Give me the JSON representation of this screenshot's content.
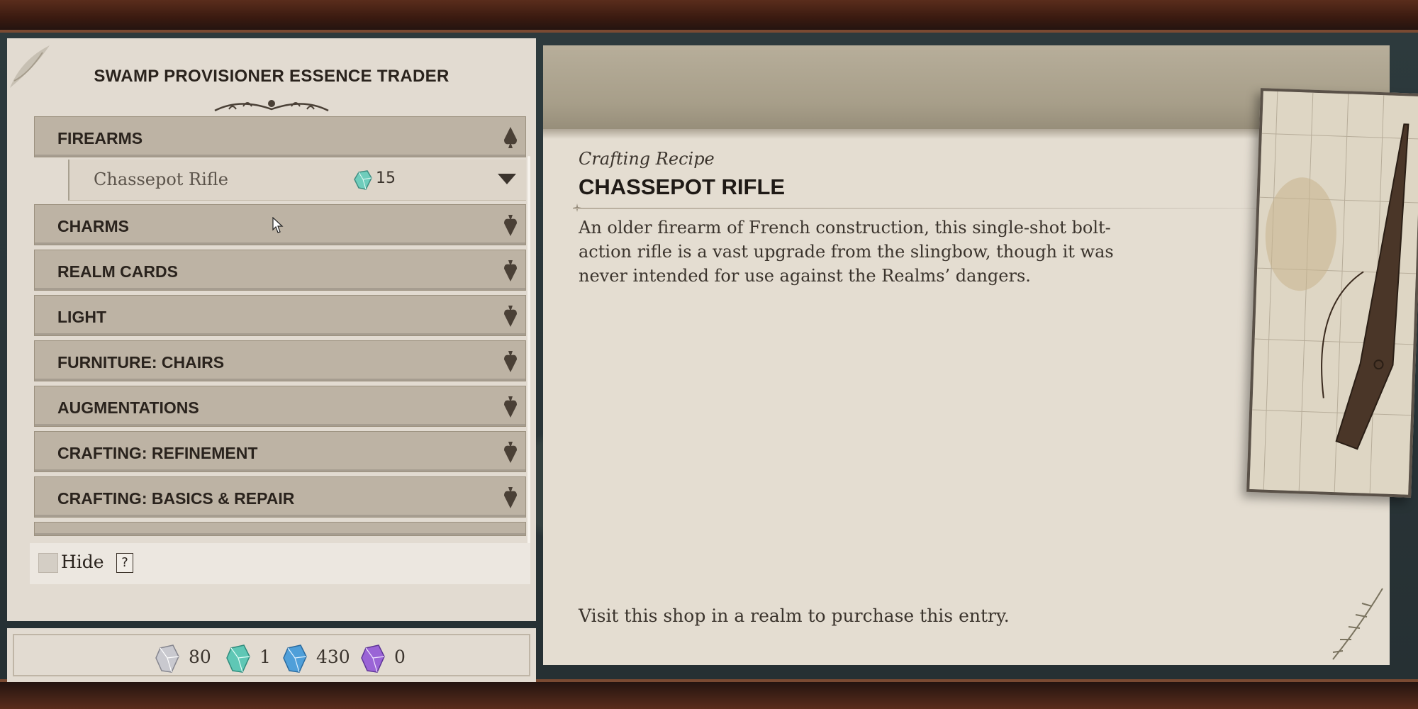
{
  "shop": {
    "title": "SWAMP PROVISIONER ESSENCE TRADER"
  },
  "categories": [
    {
      "label": "FIREARMS",
      "expanded": true
    },
    {
      "label": "CHARMS"
    },
    {
      "label": "REALM CARDS"
    },
    {
      "label": "LIGHT"
    },
    {
      "label": "FURNITURE: CHAIRS"
    },
    {
      "label": "AUGMENTATIONS"
    },
    {
      "label": "CRAFTING: REFINEMENT"
    },
    {
      "label": "CRAFTING: BASICS & REPAIR"
    }
  ],
  "selected_item": {
    "name": "Chassepot Rifle",
    "price": "15",
    "price_icon": "teal-essence-icon"
  },
  "filter": {
    "hide_label": "Hide",
    "help_symbol": "?"
  },
  "currencies": [
    {
      "icon": "white-essence-icon",
      "amount": "80",
      "color": "#c9c9cf"
    },
    {
      "icon": "teal-essence-icon",
      "amount": "1",
      "color": "#5fc7b5"
    },
    {
      "icon": "blue-essence-icon",
      "amount": "430",
      "color": "#4f9fd9"
    },
    {
      "icon": "purple-essence-icon",
      "amount": "0",
      "color": "#9a64d6"
    }
  ],
  "detail": {
    "type": "Crafting Recipe",
    "title": "CHASSEPOT RIFLE",
    "description": "An older firearm of French construction, this single-shot bolt-action rifle is a vast upgrade from the slingbow, though it was never intended for use against the Realms’ dangers.",
    "footer": "Visit this shop in a realm to purchase this entry."
  }
}
